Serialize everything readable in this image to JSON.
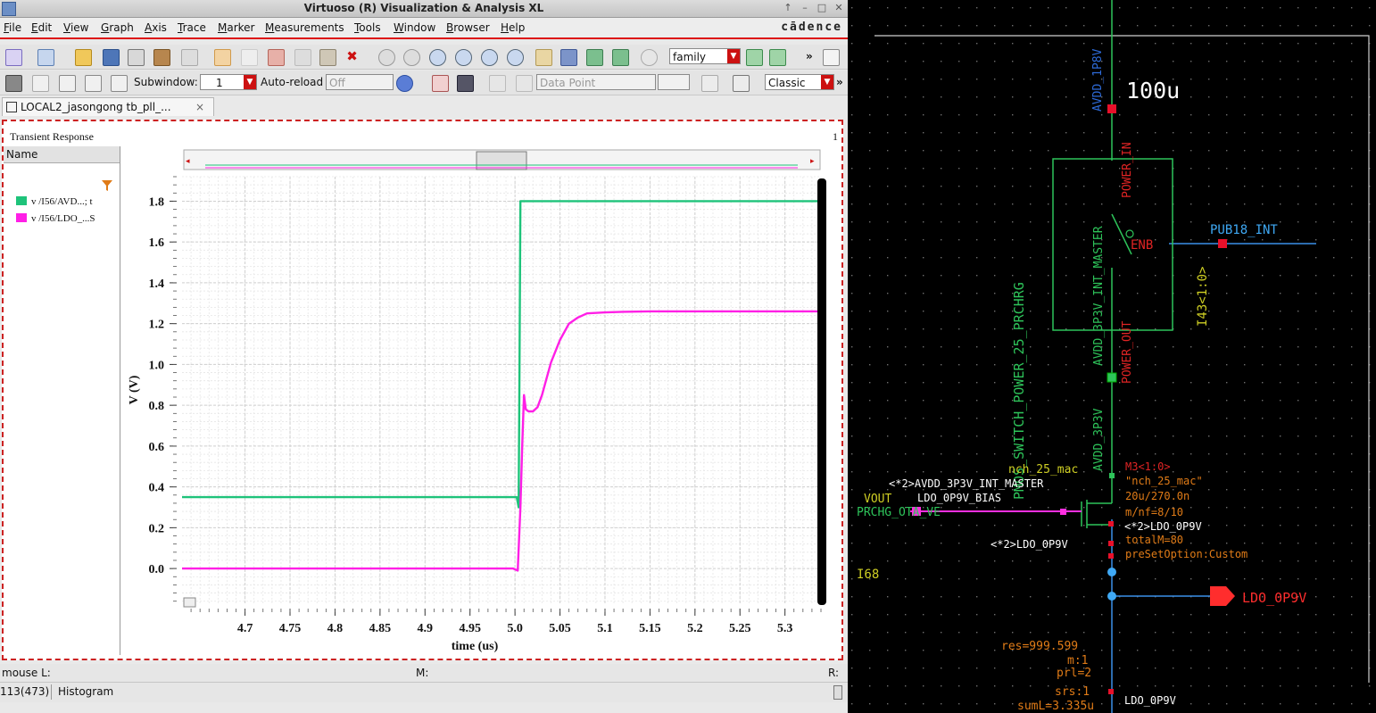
{
  "window": {
    "title": "Virtuoso (R) Visualization & Analysis XL",
    "brand": "cādence",
    "controls": [
      "↑",
      "–",
      "□",
      "✕"
    ]
  },
  "menu": [
    "File",
    "Edit",
    "View",
    "Graph",
    "Axis",
    "Trace",
    "Marker",
    "Measurements",
    "Tools",
    "Window",
    "Browser",
    "Help"
  ],
  "toolbar1": {
    "family_combo": "family",
    "overflow": "»"
  },
  "toolbar2": {
    "subwindow_label": "Subwindow:",
    "subwindow_value": "1",
    "autoreload_label": "Auto-reload",
    "autoreload_value": "Off",
    "datapoint_combo": "Data Point",
    "classic_combo": "Classic",
    "overflow": "»"
  },
  "tab": {
    "label": "LOCAL2_jasongong tb_pll_...",
    "close": "×"
  },
  "plot": {
    "title": "Transient Response",
    "subwindow_number": "1",
    "legend_header": "Name",
    "legend": [
      {
        "label": "v /I56/AVD...; t",
        "color": "#1ec37a"
      },
      {
        "label": "v /I56/LDO_...S",
        "color": "#ff1fe6"
      }
    ]
  },
  "chart_data": {
    "type": "line",
    "title": "",
    "xlabel": "time (us)",
    "ylabel": "V (V)",
    "xlim": [
      4.63,
      5.34
    ],
    "ylim": [
      -0.17,
      1.92
    ],
    "xticks": [
      4.7,
      4.75,
      4.8,
      4.85,
      4.9,
      4.95,
      5.0,
      5.05,
      5.1,
      5.15,
      5.2,
      5.25,
      5.3
    ],
    "xtick_labels": [
      "4.7",
      "4.75",
      "4.8",
      "4.85",
      "4.9",
      "4.95",
      "5.0",
      "5.05",
      "5.1",
      "5.15",
      "5.2",
      "5.25",
      "5.3"
    ],
    "yticks": [
      0.0,
      0.2,
      0.4,
      0.6,
      0.8,
      1.0,
      1.2,
      1.4,
      1.6,
      1.8
    ],
    "ytick_labels": [
      "0.0",
      "0.2",
      "0.4",
      "0.6",
      "0.8",
      "1.0",
      "1.2",
      "1.4",
      "1.6",
      "1.8"
    ],
    "grid": true,
    "series": [
      {
        "name": "v /I56/AVD...; t",
        "color": "#1ec37a",
        "x": [
          4.63,
          5.0,
          5.002,
          5.004,
          5.005,
          5.006,
          5.34
        ],
        "y": [
          0.35,
          0.35,
          0.35,
          0.3,
          1.0,
          1.8,
          1.8
        ]
      },
      {
        "name": "v /I56/LDO_...S",
        "color": "#ff1fe6",
        "x": [
          4.63,
          4.998,
          5.003,
          5.006,
          5.008,
          5.01,
          5.012,
          5.015,
          5.02,
          5.025,
          5.03,
          5.035,
          5.04,
          5.05,
          5.06,
          5.07,
          5.08,
          5.1,
          5.12,
          5.15,
          5.34
        ],
        "y": [
          0.0,
          0.0,
          -0.01,
          0.3,
          0.6,
          0.85,
          0.78,
          0.77,
          0.77,
          0.79,
          0.85,
          0.93,
          1.01,
          1.12,
          1.2,
          1.23,
          1.25,
          1.255,
          1.258,
          1.26,
          1.26
        ]
      }
    ]
  },
  "status": {
    "mouse_label": "mouse L:",
    "m_label": "M:",
    "r_label": "R:",
    "count": "113(473)",
    "histogram": "Histogram"
  },
  "schematic": {
    "labels": {
      "net_top": "AVDD_1P8V",
      "val_100u": "100u",
      "power_in": "POWER_IN",
      "enb": "ENB",
      "pub18": "PUB18_INT",
      "i43": "I43<1:0>",
      "power_out": "POWER_OUT",
      "int_master": "AVDD_3P3V_INT_MASTER",
      "prchrg": "PMOS_SWITCH_POWER_25_PRCHRG",
      "avdd3p3": "AVDD_3P3V",
      "nch": "nch_25_mac",
      "m3": "M3<1:0>",
      "nch_q": "\"nch_25_mac\"",
      "wl": "20u/270.0n",
      "mnf": "m/nf=8/10",
      "totalm": "totalM=80",
      "preset": "preSetOption:Custom",
      "pin_master": "<*2>AVDD_3P3V_INT_MASTER",
      "ldo_bias": "LDO_0P9V_BIAS",
      "vout": "VOUT",
      "prch_ota": "PRCHG_OTA_VE",
      "ldo2": "<*2>LDO_0P9V",
      "ldo2b": "<*2>LDO_0P9V",
      "i68": "I68",
      "ldo_pin": "LDO_0P9V",
      "res": "res=999.599",
      "m1": "m:1",
      "prl": "prl=2",
      "srs": "srs:1",
      "suml": "sumL=3.335u",
      "ldo_bot": "LDO_0P9V"
    }
  }
}
